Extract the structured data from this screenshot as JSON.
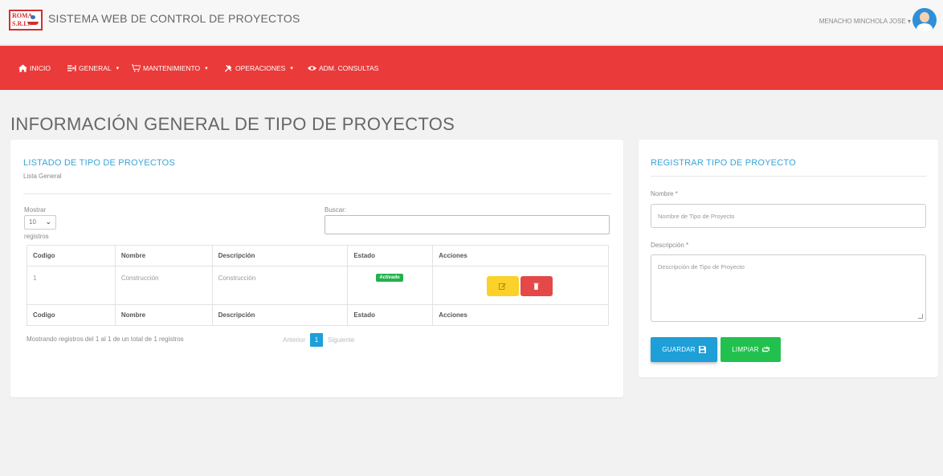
{
  "header": {
    "logo_text": "ROMA S.R.L.",
    "title": "SISTEMA WEB DE CONTROL DE PROYECTOS",
    "user": "MENACHO MINCHOLA JOSE ▾"
  },
  "nav": {
    "items": [
      {
        "label": "INICIO",
        "icon": "home-icon"
      },
      {
        "label": "GENERAL",
        "icon": "list-icon",
        "dropdown": "▾"
      },
      {
        "label": "MANTENIMIENTO",
        "icon": "cart-icon",
        "dropdown": "▾"
      },
      {
        "label": "OPERACIONES",
        "icon": "tools-icon",
        "dropdown": "▾"
      },
      {
        "label": "ADM. CONSULTAS",
        "icon": "eye-icon"
      }
    ]
  },
  "page": {
    "title": "INFORMACIÓN GENERAL DE TIPO DE PROYECTOS"
  },
  "list_card": {
    "title": "LISTADO DE TIPO DE PROYECTOS",
    "subtitle": "Lista General",
    "show_label": "Mostrar",
    "show_value": "10",
    "records_label": "registros",
    "search_label": "Buscar:",
    "columns": [
      "Codigo",
      "Nombre",
      "Descripción",
      "Estado",
      "Acciones"
    ],
    "rows": [
      {
        "codigo": "1",
        "nombre": "Construcción",
        "descripcion": "Construcción",
        "estado": "Activado"
      }
    ],
    "info": "Mostrando registros del 1 al 1 de un total de 1 registros",
    "pager": {
      "prev": "Anterior",
      "current": "1",
      "next": "Siguiente"
    }
  },
  "form_card": {
    "title": "REGISTRAR TIPO DE PROYECTO",
    "name_label": "Nombre *",
    "name_placeholder": "Nombre de Tipo de Proyecto",
    "desc_label": "Descripción *",
    "desc_placeholder": "Descripción de Tipo de Proyecto",
    "save_label": "GUARDAR",
    "clear_label": "LIMPIAR"
  },
  "colors": {
    "nav_red": "#ea3a3a",
    "accent_blue": "#1e9fd8",
    "success_green": "#22c14f",
    "edit_yellow": "#fbd12a",
    "delete_red": "#e44848"
  }
}
